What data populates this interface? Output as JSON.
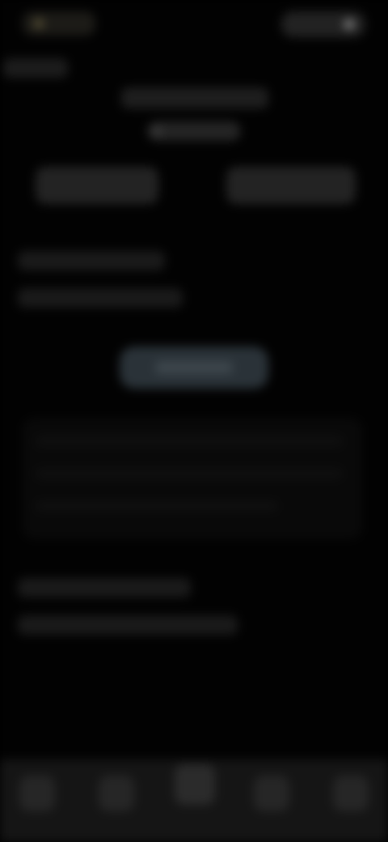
{
  "screen": {
    "colors": {
      "background": "#020202",
      "placeholder": "#1a1a1a",
      "tile": "#232323",
      "primary_button": "#2a3238",
      "tabbar": "#151515"
    },
    "status_bar": {
      "left_icon": "status-dot-icon",
      "right_icon": "status-dot-icon"
    },
    "tabbar": {
      "icons": [
        "tab-icon",
        "tab-icon",
        "tab-icon",
        "tab-icon",
        "tab-icon"
      ]
    }
  }
}
